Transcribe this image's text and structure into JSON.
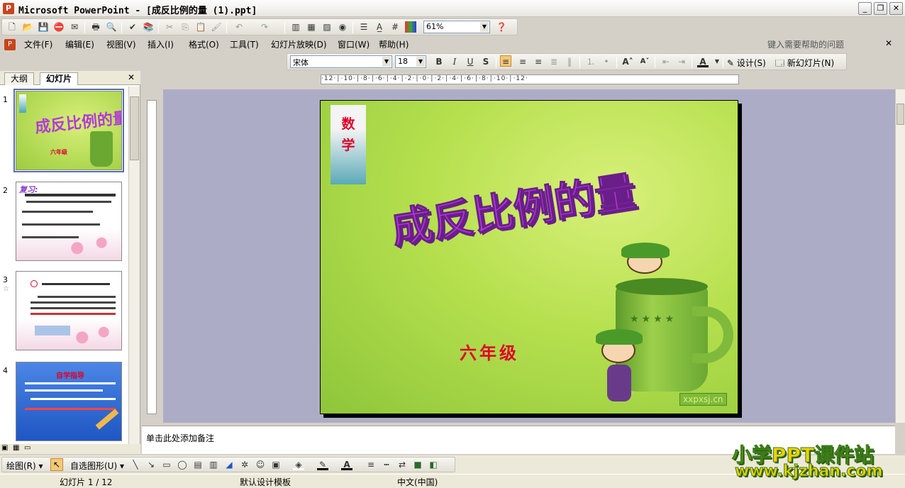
{
  "window": {
    "title": "Microsoft PowerPoint - [成反比例的量 (1).ppt]",
    "app_icon": "P"
  },
  "toolbar": {
    "zoom": "61%"
  },
  "menu": {
    "items": [
      "文件(F)",
      "编辑(E)",
      "视图(V)",
      "插入(I)",
      "格式(O)",
      "工具(T)",
      "幻灯片放映(D)",
      "窗口(W)",
      "帮助(H)"
    ],
    "help_placeholder": "键入需要帮助的问题"
  },
  "format": {
    "font": "宋体",
    "size": "18",
    "design_label": "设计(S)",
    "new_slide_label": "新幻灯片(N)"
  },
  "panes": {
    "tab_outline": "大纲",
    "tab_slides": "幻灯片"
  },
  "thumbnails": [
    {
      "num": "1"
    },
    {
      "num": "2"
    },
    {
      "num": "3"
    },
    {
      "num": "4"
    }
  ],
  "slide": {
    "subject": "数学",
    "title": "成反比例的量",
    "grade": "六年级",
    "watermark": "xxpxsj.cn"
  },
  "notes": {
    "placeholder": "单击此处添加备注"
  },
  "drawing": {
    "draw_label": "绘图(R)",
    "autoshape_label": "自选图形(U)"
  },
  "status": {
    "slide_count": "幻灯片 1 / 12",
    "template": "默认设计模板",
    "language": "中文(中国)"
  },
  "watermark_site": {
    "line1": "小学PPT课件站",
    "line2": "www.kjzhan.com"
  },
  "colors": {
    "accent": "#5a6fa6",
    "wordart": "#b43ad6",
    "red_text": "#e0002a",
    "slide_green": "#b6e04e"
  }
}
